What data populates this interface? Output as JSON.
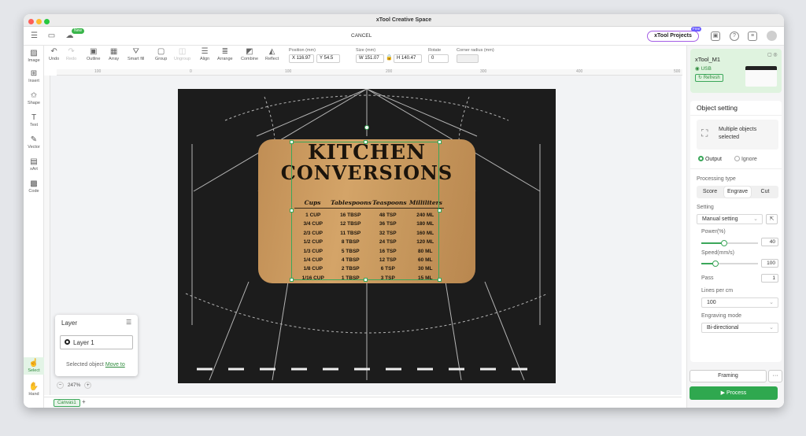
{
  "window": {
    "title": "xTool Creative Space"
  },
  "colors": {
    "accent": "#3ba75a",
    "process": "#2fa84f",
    "projects_border": "#a45ee5",
    "dot_red": "#fe5f57",
    "dot_yellow": "#febc2e",
    "dot_green": "#28c840"
  },
  "topbar": {
    "new_badge": "New",
    "cancel": "CANCEL",
    "projects_label": "xTool Projects",
    "free_badge": "Free"
  },
  "toolbar": {
    "tools": [
      {
        "label": "Undo",
        "icon": "↶",
        "disabled": false
      },
      {
        "label": "Redo",
        "icon": "↷",
        "disabled": true
      },
      {
        "label": "Outline",
        "icon": "▣",
        "disabled": false
      },
      {
        "label": "Array",
        "icon": "▦",
        "disabled": false
      },
      {
        "label": "Smart fill",
        "icon": "⛛",
        "disabled": false
      },
      {
        "label": "Group",
        "icon": "▢",
        "disabled": false
      },
      {
        "label": "Ungroup",
        "icon": "◫",
        "disabled": true
      },
      {
        "label": "Align",
        "icon": "☰",
        "disabled": false
      },
      {
        "label": "Arrange",
        "icon": "≣",
        "disabled": false
      },
      {
        "label": "Combine",
        "icon": "◩",
        "disabled": false
      },
      {
        "label": "Reflect",
        "icon": "◭",
        "disabled": false
      }
    ],
    "position_label": "Position (mm)",
    "x": "X 116.97",
    "y": "Y 54.5",
    "size_label": "Size (mm)",
    "w": "W 151.07",
    "h": "H 140.47",
    "rotate_label": "Rotate",
    "rotate": "0",
    "corner_label": "Corner radius (mm)",
    "corner": ""
  },
  "ruler": {
    "ticks": [
      "100",
      "0",
      "100",
      "200",
      "300",
      "400",
      "500"
    ]
  },
  "left_tools": [
    {
      "label": "Image",
      "icon": "▨"
    },
    {
      "label": "Insert",
      "icon": "⊞"
    },
    {
      "label": "Shape",
      "icon": "✩"
    },
    {
      "label": "Text",
      "icon": "T"
    },
    {
      "label": "Vector",
      "icon": "✎"
    },
    {
      "label": "xArt",
      "icon": "▤"
    },
    {
      "label": "Code",
      "icon": "▩"
    },
    {
      "label": "Select",
      "icon": "☝"
    },
    {
      "label": "Hand",
      "icon": "✋"
    }
  ],
  "board": {
    "title1": "KITCHEN",
    "title2": "CONVERSIONS",
    "headers": [
      "Cups",
      "Tablespoons",
      "Teaspoons",
      "Milliliters"
    ],
    "rows": [
      [
        "1 CUP",
        "16 TBSP",
        "48 TSP",
        "240 ML"
      ],
      [
        "3/4 CUP",
        "12 TBSP",
        "36 TSP",
        "180 ML"
      ],
      [
        "2/3 CUP",
        "11 TBSP",
        "32 TSP",
        "160 ML"
      ],
      [
        "1/2 CUP",
        "8 TBSP",
        "24 TSP",
        "120 ML"
      ],
      [
        "1/3 CUP",
        "5 TBSP",
        "16 TSP",
        "80 ML"
      ],
      [
        "1/4 CUP",
        "4 TBSP",
        "12 TSP",
        "60 ML"
      ],
      [
        "1/8 CUP",
        "2 TBSP",
        "6 TSP",
        "30 ML"
      ],
      [
        "1/16 CUP",
        "1 TBSP",
        "3 TSP",
        "15 ML"
      ]
    ]
  },
  "layer_panel": {
    "title": "Layer",
    "layer_name": "Layer 1",
    "selected_text": "Selected object",
    "move_to": "Move to"
  },
  "zoom": {
    "minus": "−",
    "value": "247%",
    "plus": "+"
  },
  "canvas_tab": {
    "label": "Canvas1",
    "add": "+"
  },
  "device": {
    "name": "xTool_M1",
    "connection": "USB",
    "refresh": "Refresh"
  },
  "object_setting": {
    "title": "Object setting",
    "selected_text": "Multiple objects selected",
    "output": "Output",
    "ignore": "Ignore",
    "processing_type_label": "Processing type",
    "processing_types": [
      "Score",
      "Engrave",
      "Cut"
    ],
    "setting_label": "Setting",
    "setting_value": "Manual setting",
    "power_label": "Power(%)",
    "power": "40",
    "power_fraction": 0.4,
    "speed_label": "Speed(mm/s)",
    "speed": "100",
    "speed_fraction": 0.25,
    "pass_label": "Pass",
    "pass": "1",
    "lines_label": "Lines per cm",
    "lines": "100",
    "mode_label": "Engraving mode",
    "mode": "Bi-directional"
  },
  "actions": {
    "framing": "Framing",
    "more": "···",
    "process": "Process"
  }
}
